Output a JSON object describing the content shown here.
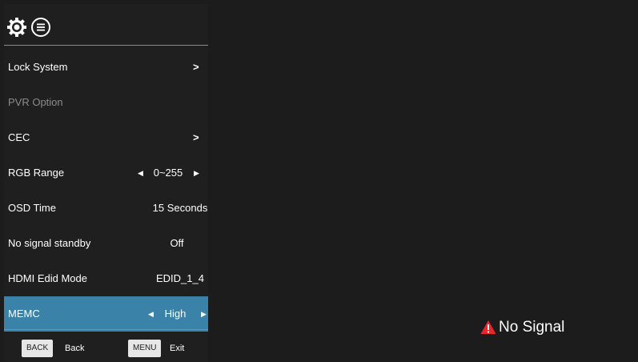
{
  "header": {
    "icons": [
      "settings-gear-icon",
      "list-menu-icon"
    ]
  },
  "menu": {
    "items": [
      {
        "label": "Lock System",
        "value": "",
        "type": "submenu",
        "state": "normal"
      },
      {
        "label": "PVR Option",
        "value": "",
        "type": "static",
        "state": "disabled"
      },
      {
        "label": "CEC",
        "value": "",
        "type": "submenu",
        "state": "normal"
      },
      {
        "label": "RGB Range",
        "value": "0~255",
        "type": "selector",
        "state": "normal"
      },
      {
        "label": "OSD Time",
        "value": "15 Seconds",
        "type": "value",
        "state": "normal"
      },
      {
        "label": "No signal standby",
        "value": "Off",
        "type": "value",
        "state": "normal"
      },
      {
        "label": "HDMI Edid Mode",
        "value": "EDID_1_4",
        "type": "value",
        "state": "normal"
      },
      {
        "label": "MEMC",
        "value": "High",
        "type": "selector",
        "state": "selected"
      }
    ],
    "submenu_glyph": ">",
    "left_arrow_glyph": "◀",
    "right_arrow_glyph": "▶"
  },
  "footer": {
    "back_key": "BACK",
    "back_label": "Back",
    "menu_key": "MENU",
    "menu_label": "Exit"
  },
  "status": {
    "no_signal_text": "No Signal",
    "icon": "warning-triangle-icon"
  },
  "colors": {
    "background": "#1c1c1c",
    "panel": "#1f1f1f",
    "selected_row": "#3a82a8",
    "disabled_text": "#8c8c8c",
    "warning_red": "#e8262b"
  }
}
